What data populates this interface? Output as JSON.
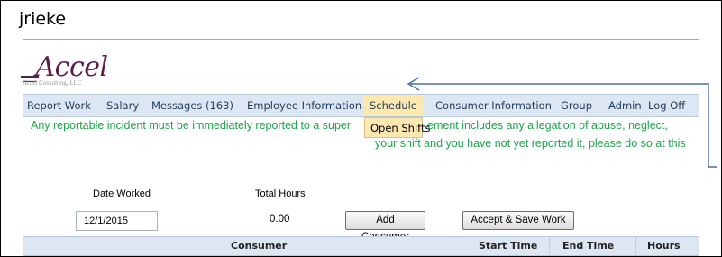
{
  "user": {
    "name": "jrieke"
  },
  "logo": {
    "mark": "_Accel",
    "subtitle": "Accel Consulting, LLC"
  },
  "nav": {
    "items": [
      "Report Work",
      "Salary",
      "Messages (163)",
      "Employee Information",
      "Schedule",
      "Consumer Information",
      "Group",
      "Admin",
      "Log Off"
    ],
    "active": "Schedule"
  },
  "dropdown": {
    "items": [
      "Open Shifts"
    ]
  },
  "notice": {
    "line1_left": "Any reportable incident must be immediately reported to a super",
    "line1_right": "ement includes any allegation of abuse, neglect,",
    "line2": "your shift and you have not yet reported it, please do so at this"
  },
  "form": {
    "date_label": "Date Worked",
    "date_value": "12/1/2015",
    "total_hours_label": "Total Hours",
    "total_hours_value": "0.00",
    "add_consumer_label": "Add Consumer",
    "accept_save_label": "Accept & Save Work"
  },
  "table": {
    "columns": [
      "Consumer",
      "Start Time",
      "End Time",
      "Hours"
    ]
  },
  "colors": {
    "nav_bg": "#dce7f3",
    "active_bg": "#fde9b0",
    "notice_text": "#1aa54a",
    "logo": "#5b1f48",
    "arrow": "#4a6fa5"
  },
  "icons": {
    "annotation_arrow": "left-arrow-annotation"
  }
}
